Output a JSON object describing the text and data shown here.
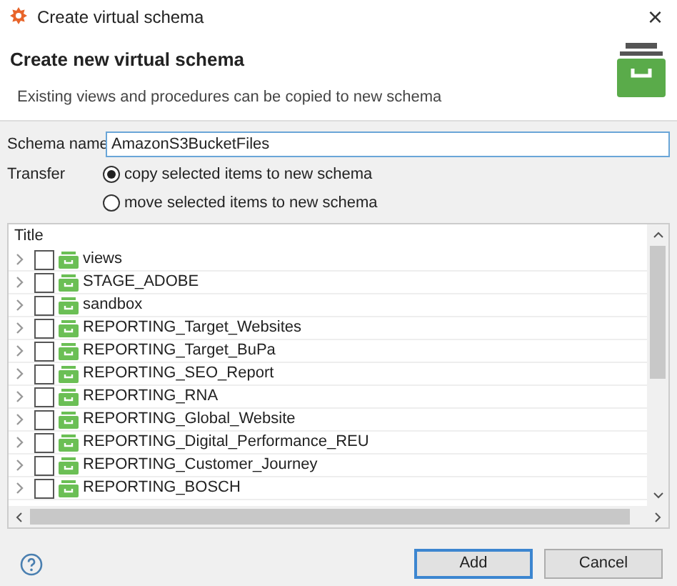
{
  "window": {
    "title": "Create virtual schema",
    "close": "×"
  },
  "header": {
    "title": "Create new virtual schema",
    "description": "Existing views and procedures can be copied to new schema"
  },
  "schema_name": {
    "label": "Schema name",
    "value": "AmazonS3BucketFiles"
  },
  "transfer": {
    "label": "Transfer",
    "options": [
      {
        "label": "copy selected items to new schema",
        "selected": true
      },
      {
        "label": "move selected items to new schema",
        "selected": false
      }
    ]
  },
  "tree": {
    "column": "Title",
    "rows": [
      {
        "label": "views",
        "checked": false
      },
      {
        "label": "STAGE_ADOBE",
        "checked": false
      },
      {
        "label": "sandbox",
        "checked": false
      },
      {
        "label": "REPORTING_Target_Websites",
        "checked": false
      },
      {
        "label": "REPORTING_Target_BuPa",
        "checked": false
      },
      {
        "label": "REPORTING_SEO_Report",
        "checked": false
      },
      {
        "label": "REPORTING_RNA",
        "checked": false
      },
      {
        "label": "REPORTING_Global_Website",
        "checked": false
      },
      {
        "label": "REPORTING_Digital_Performance_REU",
        "checked": false
      },
      {
        "label": "REPORTING_Customer_Journey",
        "checked": false
      },
      {
        "label": "REPORTING_BOSCH",
        "checked": false
      }
    ]
  },
  "buttons": [
    {
      "label": "Add",
      "default": true
    },
    {
      "label": "Cancel",
      "default": false
    }
  ]
}
